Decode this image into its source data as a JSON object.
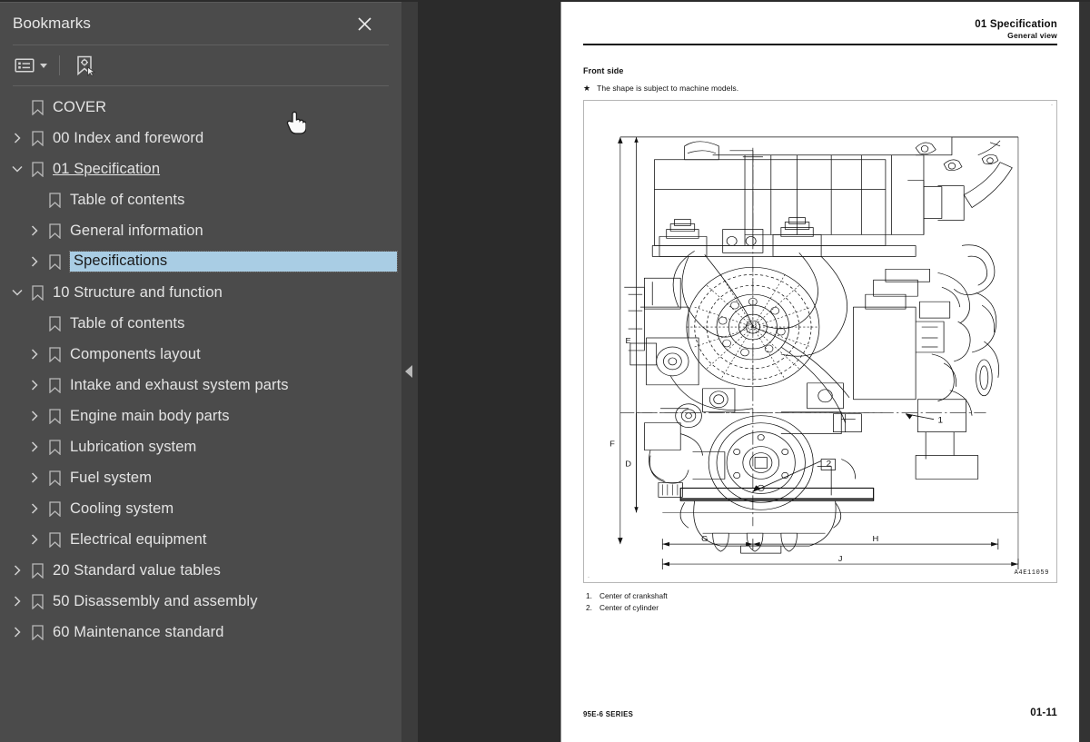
{
  "panel": {
    "title": "Bookmarks",
    "close_icon": "close-icon",
    "toolbar": {
      "options_icon": "list-options-icon",
      "options_caret_icon": "chevron-down-icon",
      "new_bookmark_icon": "new-bookmark-icon"
    }
  },
  "bookmarks": [
    {
      "label": "COVER",
      "depth": 0,
      "twisty": "none",
      "selected": false,
      "underlined": false
    },
    {
      "label": "00 Index and foreword",
      "depth": 0,
      "twisty": "collapsed",
      "selected": false,
      "underlined": false
    },
    {
      "label": "01 Specification ",
      "depth": 0,
      "twisty": "expanded",
      "selected": false,
      "underlined": true
    },
    {
      "label": "Table of contents",
      "depth": 1,
      "twisty": "none",
      "selected": false,
      "underlined": false
    },
    {
      "label": "General information",
      "depth": 1,
      "twisty": "collapsed",
      "selected": false,
      "underlined": false
    },
    {
      "label": "Specifications",
      "depth": 1,
      "twisty": "collapsed",
      "selected": true,
      "underlined": false
    },
    {
      "label": "10 Structure and function",
      "depth": 0,
      "twisty": "expanded",
      "selected": false,
      "underlined": false
    },
    {
      "label": "Table of contents",
      "depth": 1,
      "twisty": "none",
      "selected": false,
      "underlined": false
    },
    {
      "label": "Components layout",
      "depth": 1,
      "twisty": "collapsed",
      "selected": false,
      "underlined": false
    },
    {
      "label": "Intake and exhaust system parts",
      "depth": 1,
      "twisty": "collapsed",
      "selected": false,
      "underlined": false
    },
    {
      "label": "Engine main body parts",
      "depth": 1,
      "twisty": "collapsed",
      "selected": false,
      "underlined": false
    },
    {
      "label": "Lubrication system",
      "depth": 1,
      "twisty": "collapsed",
      "selected": false,
      "underlined": false
    },
    {
      "label": "Fuel system",
      "depth": 1,
      "twisty": "collapsed",
      "selected": false,
      "underlined": false
    },
    {
      "label": "Cooling system",
      "depth": 1,
      "twisty": "collapsed",
      "selected": false,
      "underlined": false
    },
    {
      "label": "Electrical equipment",
      "depth": 1,
      "twisty": "collapsed",
      "selected": false,
      "underlined": false
    },
    {
      "label": "20 Standard value tables",
      "depth": 0,
      "twisty": "collapsed",
      "selected": false,
      "underlined": false
    },
    {
      "label": "50 Disassembly and assembly",
      "depth": 0,
      "twisty": "collapsed",
      "selected": false,
      "underlined": false
    },
    {
      "label": "60 Maintenance standard",
      "depth": 0,
      "twisty": "collapsed",
      "selected": false,
      "underlined": false
    }
  ],
  "splitter": {
    "collapse_icon": "collapse-panel-left-icon"
  },
  "document": {
    "header_chapter": "01 Specification",
    "header_section": "General view",
    "front_side_title": "Front side",
    "note_star": "★",
    "note_text": "The shape is subject to machine models.",
    "drawing_code": "A4E11059",
    "dimension_labels": [
      "E",
      "F",
      "D",
      "G",
      "H",
      "J"
    ],
    "callouts": [
      "1",
      "2"
    ],
    "legend": [
      {
        "num": "1.",
        "text": "Center of crankshaft"
      },
      {
        "num": "2.",
        "text": "Center of cylinder"
      }
    ],
    "footer_series": "95E-6 SERIES",
    "footer_page": "01-11"
  },
  "cursor": {
    "icon": "pointing-hand-cursor"
  },
  "colors": {
    "panel_bg": "#4b4b4b",
    "viewer_bg": "#2b2b2b",
    "splitter_bg": "#3c3c3c",
    "selection_bg": "#a9cde4",
    "text": "#e4e4e4",
    "page_bg": "#ffffff"
  }
}
